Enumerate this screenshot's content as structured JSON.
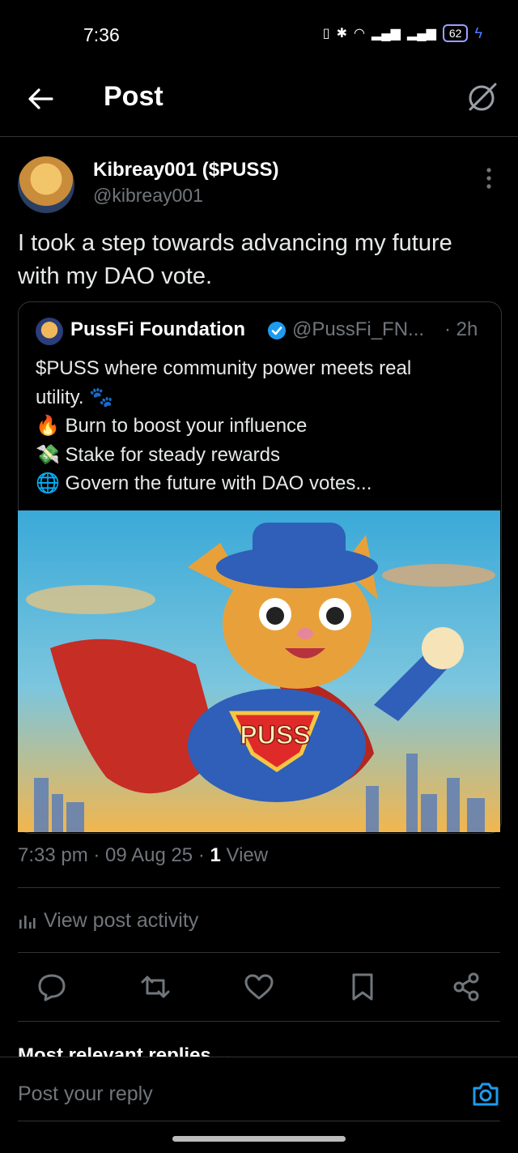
{
  "status": {
    "time": "7:36",
    "battery": "62"
  },
  "header": {
    "title": "Post",
    "back_icon": "back-arrow-icon",
    "grok_icon": "grok-icon"
  },
  "post": {
    "author_name": "Kibreay001 ($PUSS)",
    "author_handle": "@kibreay001",
    "text": "I took a step towards advancing my future with my DAO vote."
  },
  "quote": {
    "name": "PussFi Foundation",
    "handle": "@PussFi_FN...",
    "time": "· 2h",
    "lines": [
      "$PUSS where community power meets real",
      "utility. 🐾",
      "🔥 Burn to boost your influence",
      "💸 Stake for steady rewards",
      "🌐 Govern the future with DAO votes..."
    ],
    "image_text": "PUSS"
  },
  "meta": {
    "timestamp": "7:33 pm · 09 Aug 25 · ",
    "views_count": "1",
    "views_label": " View"
  },
  "activity": {
    "label": "View post activity"
  },
  "replies": {
    "sort_label": "Most relevant replies ⌄"
  },
  "reply_bar": {
    "placeholder": "Post your reply"
  },
  "colors": {
    "accent": "#1d9bf0",
    "muted": "#71767b",
    "background": "#000000",
    "border": "#2f3336"
  }
}
